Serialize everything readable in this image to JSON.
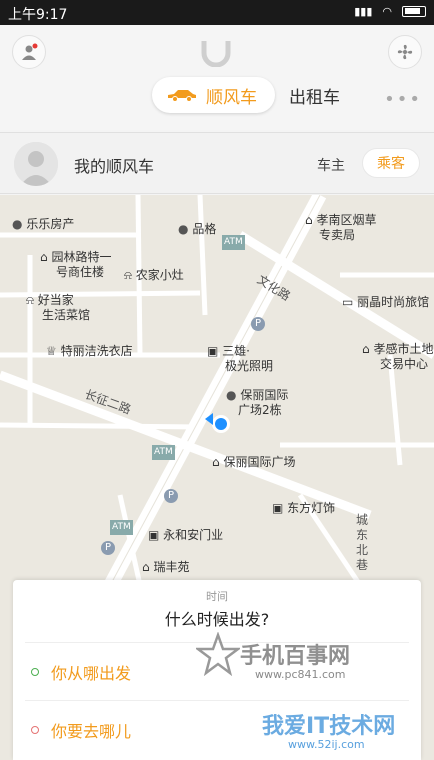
{
  "status": {
    "time": "上午9:17"
  },
  "header": {
    "tab_active": "顺风车",
    "tab_taxi": "出租车",
    "more": "•••"
  },
  "ride_bar": {
    "title": "我的顺风车",
    "role_driver": "车主",
    "role_passenger": "乘客"
  },
  "map": {
    "places": [
      {
        "name": "乐乐房产"
      },
      {
        "name": "品格"
      },
      {
        "name": "孝南区烟草"
      },
      {
        "name": "专卖局"
      },
      {
        "name": "园林路特一"
      },
      {
        "name": "号商住楼"
      },
      {
        "name": "农家小灶"
      },
      {
        "name": "好当家"
      },
      {
        "name": "生活菜馆"
      },
      {
        "name": "丽晶时尚旅馆"
      },
      {
        "name": "特丽洁洗衣店"
      },
      {
        "name": "三雄·"
      },
      {
        "name": "极光照明"
      },
      {
        "name": "孝感市土地"
      },
      {
        "name": "交易中心"
      },
      {
        "name": "保丽国际"
      },
      {
        "name": "广场2栋"
      },
      {
        "name": "保丽国际广场"
      },
      {
        "name": "东方灯饰"
      },
      {
        "name": "永和安门业"
      },
      {
        "name": "瑞丰苑"
      }
    ],
    "roads": [
      "文化路",
      "长征二路",
      "城东北巷"
    ],
    "atm": "ATM",
    "parking": "P"
  },
  "card": {
    "subtitle": "时间",
    "question": "什么时候出发?",
    "from": "你从哪出发",
    "to": "你要去哪儿"
  },
  "watermark": {
    "site1": "手机百事网",
    "url1": "www.pc841.com",
    "site2": "我爱IT技术网",
    "url2": "www.52ij.com"
  },
  "colors": {
    "accent": "#f29b1d",
    "from_dot": "#4caf50",
    "to_dot": "#e57373",
    "location": "#1e90ff"
  }
}
